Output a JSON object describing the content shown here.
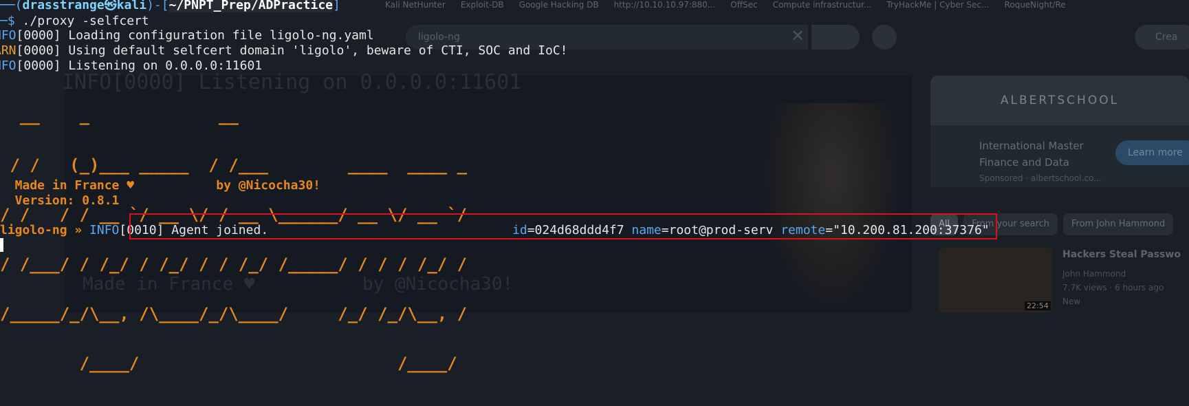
{
  "background_browser": {
    "bookmarks": [
      "Kali NetHunter",
      "Exploit-DB",
      "Google Hacking DB",
      "http://10.10.10.97:880...",
      "OffSec",
      "Compute infrastructur...",
      "TryHackMe | Cyber Sec...",
      "RoqueNight/Re"
    ],
    "search_value": "ligolo-ng",
    "create_label": "Crea",
    "ad_brand": "ALBERTSCHOOL",
    "ad_title_1": "International Master",
    "ad_title_2": "Finance and Data",
    "ad_sponsored": "Sponsored · albertschool.co...",
    "ad_cta": "Learn more",
    "chips": [
      "All",
      "From your search",
      "From John Hammond"
    ],
    "video_title": "Hackers Steal Passwo",
    "video_channel": "John Hammond",
    "video_meta": "7.7K views · 6 hours ago",
    "video_badge": "New",
    "video_duration": "22:54",
    "ghost_listening": "INFO[0000] Listening on 0.0.0.0:11601",
    "ghost_made": "Made in France ♥          by @Nicocha30!"
  },
  "terminal": {
    "prompt_lead": "──(",
    "prompt_user": "drasstrange㉿kali",
    "prompt_mid": ")-[",
    "prompt_path": "~/PNPT_Prep/ADPractice",
    "prompt_end": "]",
    "cmd_lead": "─$ ",
    "command": "./proxy -selfcert",
    "log": [
      {
        "level": "INFO",
        "code": "[0000]",
        "msg": " Loading configuration file ligolo-ng.yaml"
      },
      {
        "level": "WARN",
        "code": "[0000]",
        "msg": " Using default selfcert domain 'ligolo', beware of CTI, SOC and IoC!"
      },
      {
        "level": "INFO",
        "code": "[0000]",
        "msg": " Listening on 0.0.0.0:11601"
      }
    ],
    "log_levels_displayed": {
      "INFO": "NFO",
      "WARN": "ARN"
    },
    "banner_lines": [
      "  __    _             __",
      " / /   (_)___ _____  / /___        ____  ____ _",
      "/ /   / / __ `/ __ \\/ / __ \\______/ __ \\/ __ `/",
      "/ /___/ / /_/ / /_/ / / /_/ /_____/ / / / /_/ /",
      "/_____/_/\\__, /\\____/_/\\____/     /_/ /_/\\__, /",
      "        /____/                          /____/"
    ],
    "made_in": "  Made in France ♥           by @Nicocha30!",
    "version": "  Version: 0.8.1",
    "agent_prompt": "ligolo-ng » ",
    "agent_level": "INFO",
    "agent_code": "[0010]",
    "agent_msg": " Agent joined.",
    "agent_id_key": "id",
    "agent_id_val": "024d68ddd4f7",
    "agent_name_key": "name",
    "agent_name_val": "root@prod-serv",
    "agent_remote_key": "remote",
    "agent_remote_val": "\"10.200.81.200:37376\""
  },
  "colors": {
    "highlight": "#e0101a",
    "banner": "#e8881c",
    "info": "#5aa8f0",
    "warn": "#e7a033"
  }
}
